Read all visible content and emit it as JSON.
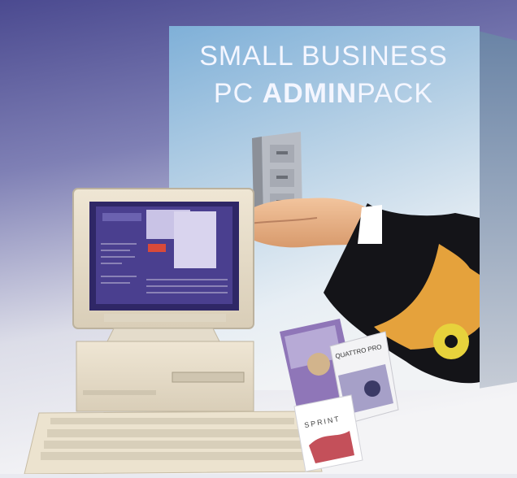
{
  "box": {
    "line1": "SMALL BUSINESS",
    "line2_prefix": "PC ",
    "line2_bold": "ADMIN",
    "line2_suffix": "PACK"
  },
  "products": {
    "quattro_pro": "QUATTRO PRO",
    "sprint": "SPRINT"
  },
  "colors": {
    "background_top": "#5a5d9a",
    "background_bottom": "#f3f3f6",
    "box_front": "#9ec2e0",
    "sleeve": "#121218",
    "cuff": "#e8a13a",
    "screen": "#4a3f8f"
  },
  "icons": [
    "filing-cabinet-icon",
    "hand-icon",
    "computer-icon",
    "keyboard-icon",
    "cufflink-icon"
  ]
}
